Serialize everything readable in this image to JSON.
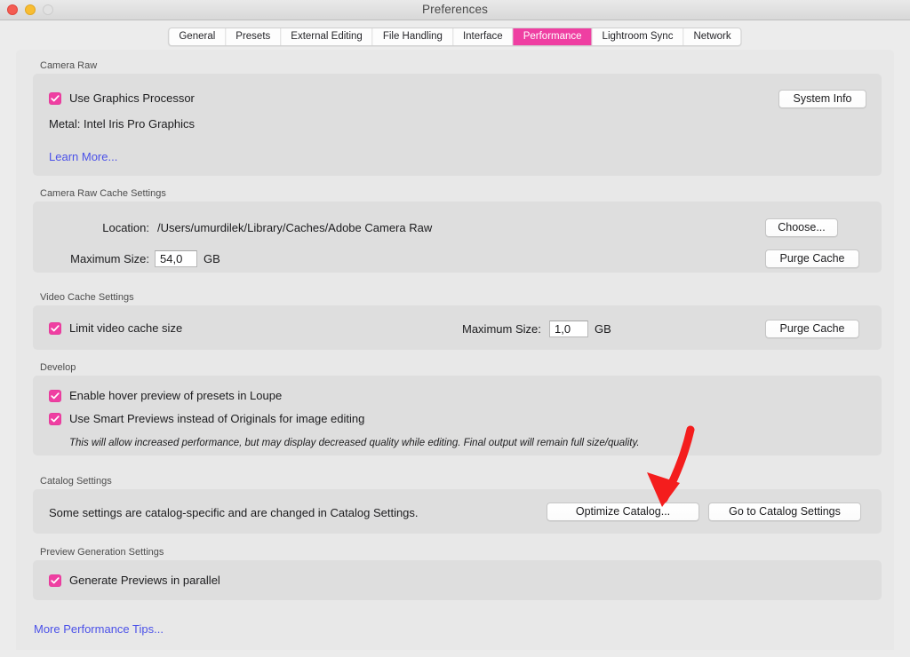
{
  "window": {
    "title": "Preferences",
    "traffic_lights": [
      "close-button",
      "minimize-button",
      "zoom-button"
    ]
  },
  "tabs": [
    {
      "label": "General",
      "active": false
    },
    {
      "label": "Presets",
      "active": false
    },
    {
      "label": "External Editing",
      "active": false
    },
    {
      "label": "File Handling",
      "active": false
    },
    {
      "label": "Interface",
      "active": false
    },
    {
      "label": "Performance",
      "active": true
    },
    {
      "label": "Lightroom Sync",
      "active": false
    },
    {
      "label": "Network",
      "active": false
    }
  ],
  "colors": {
    "accent": "#ef3fa2",
    "link": "#4b51e8",
    "annotation_arrow": "#f41d1d",
    "panel": "#dedede",
    "content_bg": "#e8e8e8"
  },
  "sections": {
    "camera_raw": {
      "label": "Camera Raw",
      "use_gpu_checkbox": {
        "label": "Use Graphics Processor",
        "checked": true
      },
      "gpu_info": "Metal: Intel Iris Pro Graphics",
      "learn_more": "Learn More...",
      "system_info_button": "System Info"
    },
    "camera_raw_cache": {
      "label": "Camera Raw Cache Settings",
      "location_label": "Location:",
      "location_value": "/Users/umurdilek/Library/Caches/Adobe Camera Raw",
      "choose_button": "Choose...",
      "max_size_label": "Maximum Size:",
      "max_size_value": "54,0",
      "max_size_unit": "GB",
      "purge_cache_button": "Purge Cache"
    },
    "video_cache": {
      "label": "Video Cache Settings",
      "limit_checkbox": {
        "label": "Limit video cache size",
        "checked": true
      },
      "max_size_label": "Maximum Size:",
      "max_size_value": "1,0",
      "max_size_unit": "GB",
      "purge_cache_button": "Purge Cache"
    },
    "develop": {
      "label": "Develop",
      "hover_preview_checkbox": {
        "label": "Enable hover preview of presets in Loupe",
        "checked": true
      },
      "smart_previews_checkbox": {
        "label": "Use Smart Previews instead of Originals for image editing",
        "checked": true
      },
      "note": "This will allow increased performance, but may display decreased quality while editing. Final output will remain full size/quality."
    },
    "catalog": {
      "label": "Catalog Settings",
      "description": "Some settings are catalog-specific and are changed in Catalog Settings.",
      "optimize_button": "Optimize Catalog...",
      "goto_button": "Go to Catalog Settings"
    },
    "preview_generation": {
      "label": "Preview Generation Settings",
      "parallel_checkbox": {
        "label": "Generate Previews in parallel",
        "checked": true
      }
    },
    "footer": {
      "more_tips_link": "More Performance Tips..."
    }
  }
}
